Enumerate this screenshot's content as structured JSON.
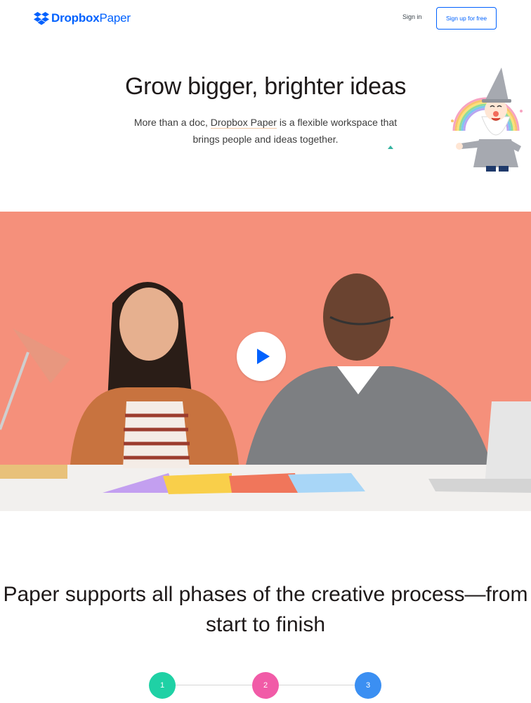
{
  "header": {
    "logo_brand": "Dropbox",
    "logo_product": "Paper",
    "signin_label": "Sign in",
    "signup_label": "Sign up for free"
  },
  "hero": {
    "title": "Grow bigger, brighter ideas",
    "subtitle_part1": "More than a doc, ",
    "subtitle_highlight": "Dropbox Paper",
    "subtitle_part2": " is a flexible workspace that brings people and ideas together."
  },
  "video": {
    "play_icon": "play-icon",
    "background_color": "#f5907b"
  },
  "section": {
    "title": "Paper supports all phases of the creative process—from start to finish"
  },
  "steps": [
    {
      "label": "1",
      "color": "#1fd1a5"
    },
    {
      "label": "2",
      "color": "#f15ba7"
    },
    {
      "label": "3",
      "color": "#3b8ff2"
    }
  ],
  "colors": {
    "brand_blue": "#0061fe"
  }
}
